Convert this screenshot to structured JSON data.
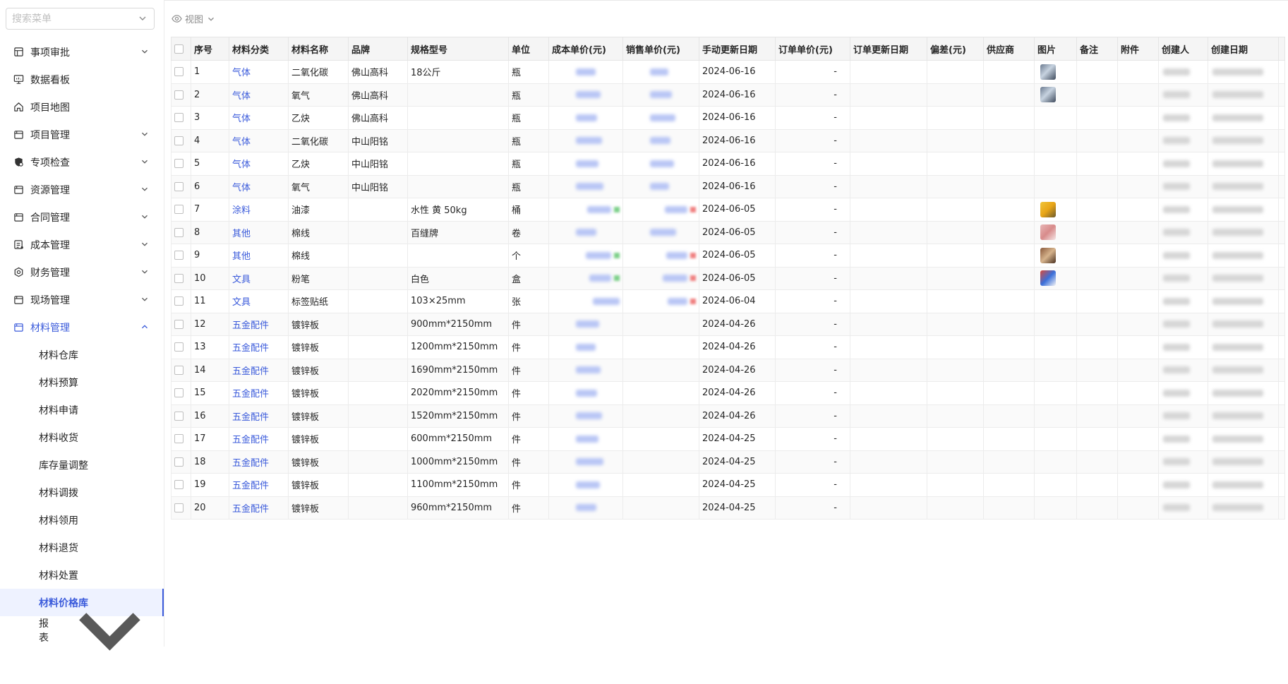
{
  "search": {
    "placeholder": "搜索菜单"
  },
  "view": {
    "label": "视图"
  },
  "menu": {
    "items": [
      {
        "label": "事项审批",
        "icon": "approval-icon",
        "has_arrow": true
      },
      {
        "label": "数据看板",
        "icon": "dashboard-icon",
        "has_arrow": false
      },
      {
        "label": "项目地图",
        "icon": "home-icon",
        "has_arrow": false
      },
      {
        "label": "项目管理",
        "icon": "folder-icon",
        "has_arrow": true
      },
      {
        "label": "专项检查",
        "icon": "shield-icon",
        "has_arrow": true
      },
      {
        "label": "资源管理",
        "icon": "folder-icon",
        "has_arrow": true
      },
      {
        "label": "合同管理",
        "icon": "folder-icon",
        "has_arrow": true
      },
      {
        "label": "成本管理",
        "icon": "ledger-icon",
        "has_arrow": true
      },
      {
        "label": "财务管理",
        "icon": "settings-icon",
        "has_arrow": true
      },
      {
        "label": "现场管理",
        "icon": "folder-icon",
        "has_arrow": true
      },
      {
        "label": "材料管理",
        "icon": "folder-icon",
        "has_arrow": true,
        "expanded": true
      }
    ],
    "sub_items": [
      "材料仓库",
      "材料预算",
      "材料申请",
      "材料收货",
      "库存量调整",
      "材料调拨",
      "材料领用",
      "材料退货",
      "材料处置",
      "材料价格库"
    ],
    "selected_sub": "材料价格库",
    "last_item": {
      "label": "报表",
      "has_arrow": true
    }
  },
  "table": {
    "headers": [
      "序号",
      "材料分类",
      "材料名称",
      "品牌",
      "规格型号",
      "单位",
      "成本单价(元)",
      "销售单价(元)",
      "手动更新日期",
      "订单单价(元)",
      "订单更新日期",
      "偏差(元)",
      "供应商",
      "图片",
      "备注",
      "附件",
      "创建人",
      "创建日期"
    ],
    "rows": [
      {
        "no": "1",
        "cat": "气体",
        "name": "二氧化碳",
        "brand": "佛山高科",
        "spec": "18公斤",
        "unit": "瓶",
        "date": "2024-06-16",
        "order": "-",
        "img": "gas",
        "sale": true,
        "trend": ""
      },
      {
        "no": "2",
        "cat": "气体",
        "name": "氧气",
        "brand": "佛山高科",
        "spec": "",
        "unit": "瓶",
        "date": "2024-06-16",
        "order": "-",
        "img": "gas",
        "sale": true,
        "trend": ""
      },
      {
        "no": "3",
        "cat": "气体",
        "name": "乙炔",
        "brand": "佛山高科",
        "spec": "",
        "unit": "瓶",
        "date": "2024-06-16",
        "order": "-",
        "img": "",
        "sale": true,
        "trend": ""
      },
      {
        "no": "4",
        "cat": "气体",
        "name": "二氧化碳",
        "brand": "中山阳铭",
        "spec": "",
        "unit": "瓶",
        "date": "2024-06-16",
        "order": "-",
        "img": "",
        "sale": true,
        "trend": ""
      },
      {
        "no": "5",
        "cat": "气体",
        "name": "乙炔",
        "brand": "中山阳铭",
        "spec": "",
        "unit": "瓶",
        "date": "2024-06-16",
        "order": "-",
        "img": "",
        "sale": true,
        "trend": ""
      },
      {
        "no": "6",
        "cat": "气体",
        "name": "氧气",
        "brand": "中山阳铭",
        "spec": "",
        "unit": "瓶",
        "date": "2024-06-16",
        "order": "-",
        "img": "",
        "sale": true,
        "trend": ""
      },
      {
        "no": "7",
        "cat": "涂料",
        "name": "油漆",
        "brand": "",
        "spec": "水性 黄 50kg",
        "unit": "桶",
        "date": "2024-06-05",
        "order": "-",
        "img": "paint",
        "sale": true,
        "trend": "mixed"
      },
      {
        "no": "8",
        "cat": "其他",
        "name": "棉线",
        "brand": "",
        "spec": "百缝牌",
        "unit": "卷",
        "date": "2024-06-05",
        "order": "-",
        "img": "thread",
        "sale": true,
        "trend": ""
      },
      {
        "no": "9",
        "cat": "其他",
        "name": "棉线",
        "brand": "",
        "spec": "",
        "unit": "个",
        "date": "2024-06-05",
        "order": "-",
        "img": "thread2",
        "sale": true,
        "trend": "mixed"
      },
      {
        "no": "10",
        "cat": "文具",
        "name": "粉笔",
        "brand": "",
        "spec": "白色",
        "unit": "盒",
        "date": "2024-06-05",
        "order": "-",
        "img": "chalk",
        "sale": true,
        "trend": "mixed"
      },
      {
        "no": "11",
        "cat": "文具",
        "name": "标签贴纸",
        "brand": "",
        "spec": "103×25mm",
        "unit": "张",
        "date": "2024-06-04",
        "order": "-",
        "img": "",
        "sale": true,
        "trend": "up"
      },
      {
        "no": "12",
        "cat": "五金配件",
        "name": "镀锌板",
        "brand": "",
        "spec": "900mm*2150mm",
        "unit": "件",
        "date": "2024-04-26",
        "order": "-",
        "img": "",
        "sale": false,
        "trend": ""
      },
      {
        "no": "13",
        "cat": "五金配件",
        "name": "镀锌板",
        "brand": "",
        "spec": "1200mm*2150mm",
        "unit": "件",
        "date": "2024-04-26",
        "order": "-",
        "img": "",
        "sale": false,
        "trend": ""
      },
      {
        "no": "14",
        "cat": "五金配件",
        "name": "镀锌板",
        "brand": "",
        "spec": "1690mm*2150mm",
        "unit": "件",
        "date": "2024-04-26",
        "order": "-",
        "img": "",
        "sale": false,
        "trend": ""
      },
      {
        "no": "15",
        "cat": "五金配件",
        "name": "镀锌板",
        "brand": "",
        "spec": "2020mm*2150mm",
        "unit": "件",
        "date": "2024-04-26",
        "order": "-",
        "img": "",
        "sale": false,
        "trend": ""
      },
      {
        "no": "16",
        "cat": "五金配件",
        "name": "镀锌板",
        "brand": "",
        "spec": "1520mm*2150mm",
        "unit": "件",
        "date": "2024-04-26",
        "order": "-",
        "img": "",
        "sale": false,
        "trend": ""
      },
      {
        "no": "17",
        "cat": "五金配件",
        "name": "镀锌板",
        "brand": "",
        "spec": "600mm*2150mm",
        "unit": "件",
        "date": "2024-04-25",
        "order": "-",
        "img": "",
        "sale": false,
        "trend": ""
      },
      {
        "no": "18",
        "cat": "五金配件",
        "name": "镀锌板",
        "brand": "",
        "spec": "1000mm*2150mm",
        "unit": "件",
        "date": "2024-04-25",
        "order": "-",
        "img": "",
        "sale": false,
        "trend": ""
      },
      {
        "no": "19",
        "cat": "五金配件",
        "name": "镀锌板",
        "brand": "",
        "spec": "1100mm*2150mm",
        "unit": "件",
        "date": "2024-04-25",
        "order": "-",
        "img": "",
        "sale": false,
        "trend": ""
      },
      {
        "no": "20",
        "cat": "五金配件",
        "name": "镀锌板",
        "brand": "",
        "spec": "960mm*2150mm",
        "unit": "件",
        "date": "2024-04-25",
        "order": "-",
        "img": "",
        "sale": false,
        "trend": ""
      }
    ]
  },
  "colors": {
    "link": "#3b5bdb",
    "header_bg": "#f5f5f5",
    "selected_bg": "#eef2ff"
  }
}
